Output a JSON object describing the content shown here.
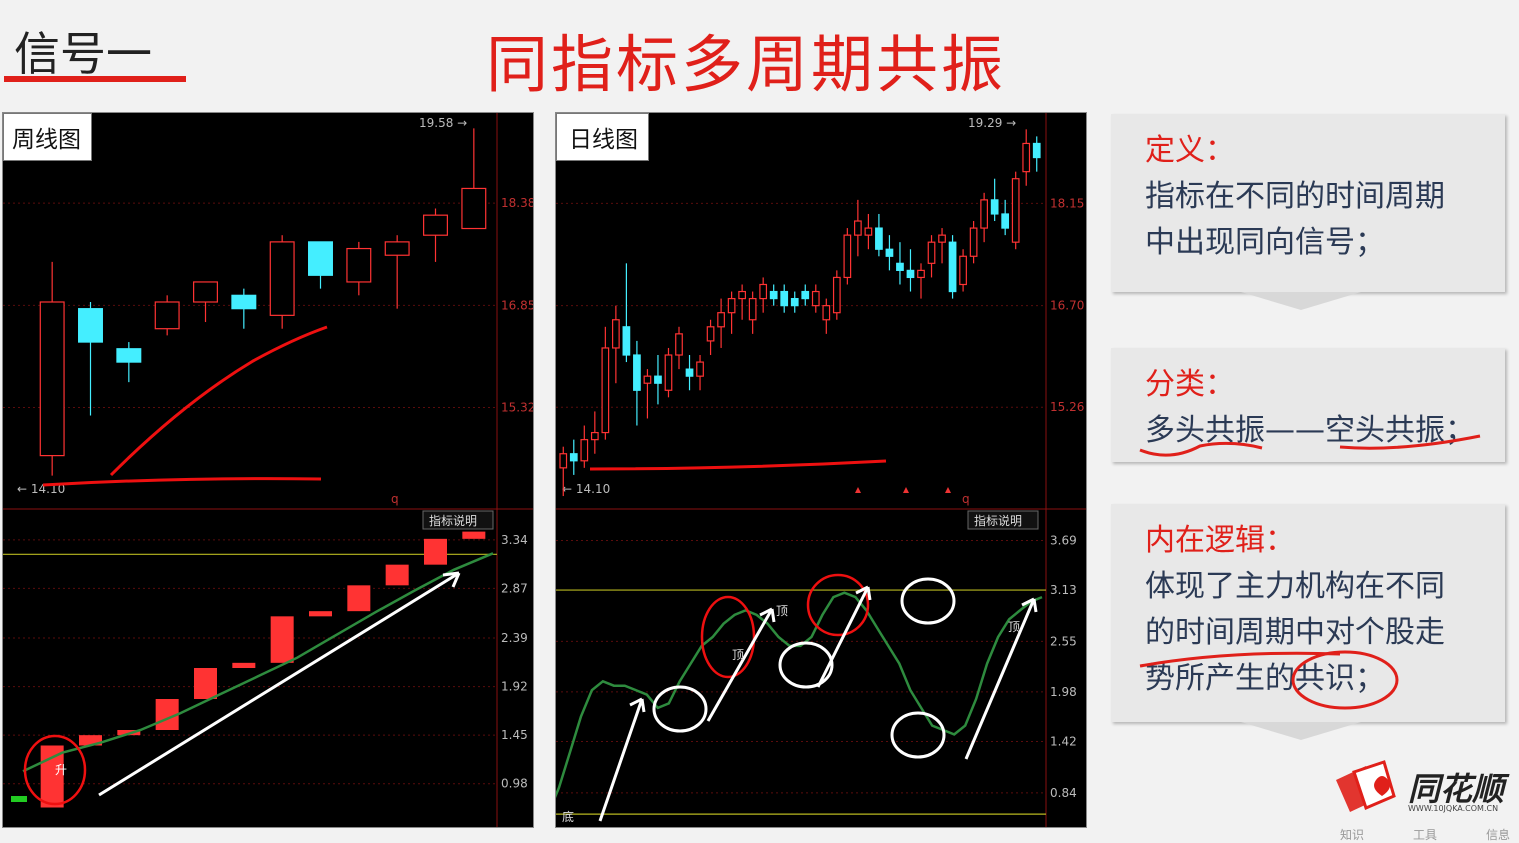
{
  "header": {
    "signal_label": "信号一",
    "title": "同指标多周期共振"
  },
  "weekly": {
    "label": "周线图",
    "price_ticks": [
      "19.58",
      "18.38",
      "16.85",
      "15.32"
    ],
    "low_label": "14.10",
    "q_mark": "q",
    "indicator_button": "指标说明",
    "ind_ticks": [
      "3.34",
      "2.87",
      "2.39",
      "1.92",
      "1.45",
      "0.98"
    ],
    "sheng_mark": "升"
  },
  "daily": {
    "label": "日线图",
    "price_ticks": [
      "19.29",
      "18.15",
      "16.70",
      "15.26"
    ],
    "low_label": "14.10",
    "q_mark": "q",
    "indicator_button": "指标说明",
    "ind_ticks": [
      "3.69",
      "3.13",
      "2.55",
      "1.98",
      "1.42",
      "0.84"
    ],
    "marks": [
      "顶",
      "顶",
      "顶",
      "底"
    ]
  },
  "boxes": [
    {
      "head": "定义：",
      "lines": [
        "指标在不同的时间周期",
        "中出现同向信号；"
      ]
    },
    {
      "head": "分类：",
      "lines": [
        "多头共振——空头共振；"
      ]
    },
    {
      "head": "内在逻辑：",
      "lines": [
        "体现了主力机构在不同",
        "的时间周期中对个股走",
        "势所产生的共识；"
      ]
    }
  ],
  "logo": {
    "name": "同花顺",
    "url": "WWW.10JQKA.COM.CN"
  },
  "bottom_tabs": [
    "知识",
    "工具",
    "信息"
  ],
  "colors": {
    "accent": "#e0201a",
    "candle_up": "#ff3333",
    "candle_down": "#44eeff",
    "ma": "#2e8b3e",
    "level": "#b8b820"
  },
  "chart_data": [
    {
      "type": "candlestick",
      "title": "周线图",
      "ylim": [
        14.1,
        19.58
      ],
      "price_ticks": [
        18.38,
        16.85,
        15.32
      ],
      "candles": [
        {
          "o": 14.6,
          "h": 17.5,
          "l": 14.3,
          "c": 16.9
        },
        {
          "o": 16.8,
          "h": 16.9,
          "l": 15.2,
          "c": 16.3
        },
        {
          "o": 16.2,
          "h": 16.3,
          "l": 15.7,
          "c": 16.0
        },
        {
          "o": 16.5,
          "h": 17.0,
          "l": 16.4,
          "c": 16.9
        },
        {
          "o": 16.9,
          "h": 17.1,
          "l": 16.6,
          "c": 17.2
        },
        {
          "o": 17.0,
          "h": 17.1,
          "l": 16.5,
          "c": 16.8
        },
        {
          "o": 16.7,
          "h": 17.9,
          "l": 16.5,
          "c": 17.8
        },
        {
          "o": 17.8,
          "h": 17.8,
          "l": 17.1,
          "c": 17.3
        },
        {
          "o": 17.2,
          "h": 17.8,
          "l": 17.0,
          "c": 17.7
        },
        {
          "o": 17.6,
          "h": 17.9,
          "l": 16.8,
          "c": 17.8
        },
        {
          "o": 17.9,
          "h": 18.3,
          "l": 17.5,
          "c": 18.2
        },
        {
          "o": 18.0,
          "h": 19.5,
          "l": 18.0,
          "c": 18.6
        }
      ],
      "indicator": {
        "ylim": [
          0.6,
          3.6
        ],
        "ticks": [
          3.34,
          2.87,
          2.39,
          1.92,
          1.45,
          0.98
        ],
        "bars": [
          [
            0.75,
            1.35
          ],
          [
            1.35,
            1.45
          ],
          [
            1.45,
            1.5
          ],
          [
            1.5,
            1.8
          ],
          [
            1.8,
            2.1
          ],
          [
            2.1,
            2.15
          ],
          [
            2.15,
            2.6
          ],
          [
            2.6,
            2.65
          ],
          [
            2.65,
            2.9
          ],
          [
            2.9,
            3.1
          ],
          [
            3.1,
            3.35
          ],
          [
            3.35,
            3.42
          ]
        ],
        "ma": [
          1.1,
          1.28,
          1.38,
          1.5,
          1.66,
          1.84,
          2.02,
          2.2,
          2.42,
          2.64,
          2.85,
          3.05,
          3.21
        ],
        "level": 3.2
      }
    },
    {
      "type": "candlestick",
      "title": "日线图",
      "ylim": [
        14.1,
        19.29
      ],
      "price_ticks": [
        18.15,
        16.7,
        15.26
      ],
      "candles": [
        {
          "o": 14.4,
          "h": 14.7,
          "l": 14.0,
          "c": 14.6
        },
        {
          "o": 14.6,
          "h": 14.8,
          "l": 14.3,
          "c": 14.5
        },
        {
          "o": 14.5,
          "h": 15.0,
          "l": 14.4,
          "c": 14.8
        },
        {
          "o": 14.8,
          "h": 15.2,
          "l": 14.6,
          "c": 14.9
        },
        {
          "o": 14.9,
          "h": 16.4,
          "l": 14.8,
          "c": 16.1
        },
        {
          "o": 16.1,
          "h": 16.7,
          "l": 15.6,
          "c": 16.5
        },
        {
          "o": 16.4,
          "h": 17.3,
          "l": 15.9,
          "c": 16.0
        },
        {
          "o": 16.0,
          "h": 16.2,
          "l": 15.0,
          "c": 15.5
        },
        {
          "o": 15.6,
          "h": 15.8,
          "l": 15.1,
          "c": 15.7
        },
        {
          "o": 15.7,
          "h": 16.0,
          "l": 15.3,
          "c": 15.6
        },
        {
          "o": 15.5,
          "h": 16.1,
          "l": 15.4,
          "c": 16.0
        },
        {
          "o": 16.0,
          "h": 16.4,
          "l": 15.8,
          "c": 16.3
        },
        {
          "o": 15.8,
          "h": 16.0,
          "l": 15.5,
          "c": 15.7
        },
        {
          "o": 15.7,
          "h": 16.0,
          "l": 15.5,
          "c": 15.9
        },
        {
          "o": 16.2,
          "h": 16.5,
          "l": 16.0,
          "c": 16.4
        },
        {
          "o": 16.4,
          "h": 16.8,
          "l": 16.1,
          "c": 16.6
        },
        {
          "o": 16.6,
          "h": 16.9,
          "l": 16.3,
          "c": 16.8
        },
        {
          "o": 16.8,
          "h": 17.0,
          "l": 16.5,
          "c": 16.9
        },
        {
          "o": 16.5,
          "h": 16.9,
          "l": 16.3,
          "c": 16.8
        },
        {
          "o": 16.8,
          "h": 17.1,
          "l": 16.6,
          "c": 17.0
        },
        {
          "o": 16.9,
          "h": 17.0,
          "l": 16.7,
          "c": 16.8
        },
        {
          "o": 16.9,
          "h": 17.0,
          "l": 16.6,
          "c": 16.7
        },
        {
          "o": 16.8,
          "h": 16.9,
          "l": 16.6,
          "c": 16.7
        },
        {
          "o": 16.9,
          "h": 17.0,
          "l": 16.7,
          "c": 16.8
        },
        {
          "o": 16.7,
          "h": 17.0,
          "l": 16.6,
          "c": 16.9
        },
        {
          "o": 16.5,
          "h": 16.8,
          "l": 16.3,
          "c": 16.7
        },
        {
          "o": 16.6,
          "h": 17.2,
          "l": 16.5,
          "c": 17.1
        },
        {
          "o": 17.1,
          "h": 17.8,
          "l": 17.0,
          "c": 17.7
        },
        {
          "o": 17.7,
          "h": 18.2,
          "l": 17.4,
          "c": 17.9
        },
        {
          "o": 17.7,
          "h": 18.0,
          "l": 17.5,
          "c": 17.8
        },
        {
          "o": 17.8,
          "h": 18.0,
          "l": 17.4,
          "c": 17.5
        },
        {
          "o": 17.5,
          "h": 17.7,
          "l": 17.2,
          "c": 17.4
        },
        {
          "o": 17.3,
          "h": 17.6,
          "l": 17.0,
          "c": 17.2
        },
        {
          "o": 17.2,
          "h": 17.5,
          "l": 16.9,
          "c": 17.1
        },
        {
          "o": 17.1,
          "h": 17.3,
          "l": 16.8,
          "c": 17.2
        },
        {
          "o": 17.3,
          "h": 17.7,
          "l": 17.1,
          "c": 17.6
        },
        {
          "o": 17.6,
          "h": 17.8,
          "l": 17.3,
          "c": 17.7
        },
        {
          "o": 17.6,
          "h": 17.7,
          "l": 16.8,
          "c": 16.9
        },
        {
          "o": 17.0,
          "h": 17.5,
          "l": 16.9,
          "c": 17.4
        },
        {
          "o": 17.4,
          "h": 17.9,
          "l": 17.3,
          "c": 17.8
        },
        {
          "o": 17.8,
          "h": 18.3,
          "l": 17.6,
          "c": 18.2
        },
        {
          "o": 18.2,
          "h": 18.5,
          "l": 17.9,
          "c": 18.0
        },
        {
          "o": 18.0,
          "h": 18.2,
          "l": 17.7,
          "c": 17.8
        },
        {
          "o": 17.6,
          "h": 18.6,
          "l": 17.5,
          "c": 18.5
        },
        {
          "o": 18.6,
          "h": 19.2,
          "l": 18.4,
          "c": 19.0
        },
        {
          "o": 19.0,
          "h": 19.1,
          "l": 18.6,
          "c": 18.8
        }
      ],
      "indicator": {
        "ylim": [
          0.5,
          4.0
        ],
        "ticks": [
          3.69,
          3.13,
          2.55,
          1.98,
          1.42,
          0.84
        ],
        "ma": [
          0.6,
          0.9,
          1.3,
          1.7,
          2.0,
          2.1,
          2.05,
          2.05,
          2.0,
          1.95,
          1.8,
          1.85,
          2.1,
          2.3,
          2.5,
          2.6,
          2.75,
          2.85,
          2.9,
          2.85,
          2.75,
          2.6,
          2.5,
          2.5,
          2.6,
          2.85,
          3.05,
          3.1,
          3.05,
          2.9,
          2.7,
          2.5,
          2.3,
          2.0,
          1.8,
          1.6,
          1.55,
          1.5,
          1.6,
          1.9,
          2.3,
          2.6,
          2.8,
          2.9,
          3.0,
          3.05
        ],
        "level_top": 3.13,
        "level_bottom": 0.6
      }
    }
  ]
}
